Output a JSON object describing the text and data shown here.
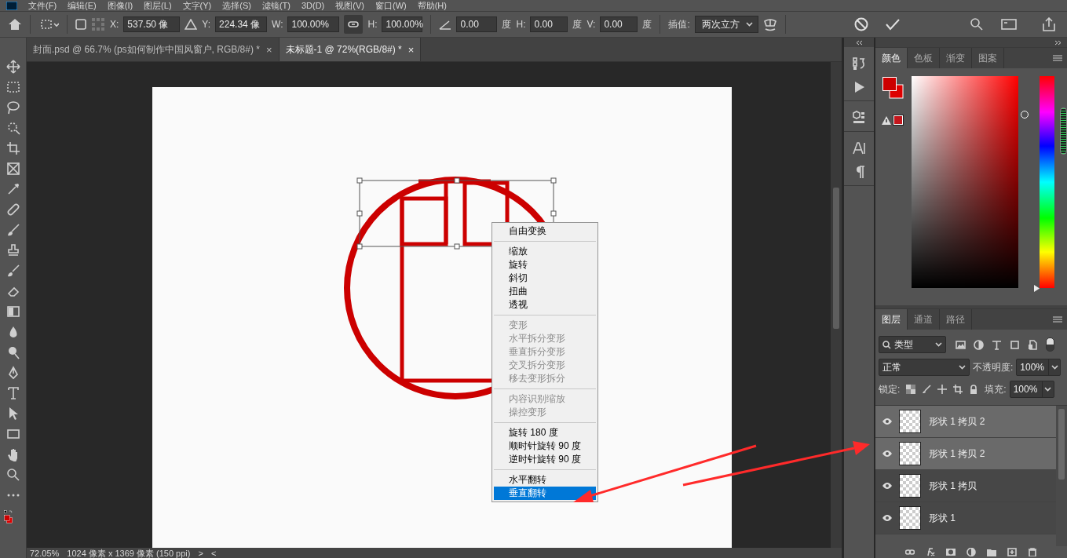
{
  "menu_bar": [
    "文件(F)",
    "编辑(E)",
    "图像(I)",
    "图层(L)",
    "文字(Y)",
    "选择(S)",
    "滤镜(T)",
    "3D(D)",
    "视图(V)",
    "窗口(W)",
    "帮助(H)"
  ],
  "options_bar": {
    "ref_point_checked": false,
    "x_label": "X:",
    "x_value": "537.50 像",
    "y_label": "Y:",
    "y_value": "224.34 像",
    "w_label": "W:",
    "w_value": "100.00%",
    "h_label": "H:",
    "h_value": "100.00%",
    "link_on": true,
    "angle_value": "0.00",
    "angle_unit": "度",
    "skew_h_label": "H:",
    "skew_h_value": "0.00",
    "skew_h_unit": "度",
    "skew_v_label": "V:",
    "skew_v_value": "0.00",
    "skew_v_unit": "度",
    "interp_label": "插值:",
    "interp_value": "两次立方"
  },
  "doc_tabs": [
    {
      "title": "封面.psd @ 66.7% (ps如何制作中国风窗户, RGB/8#) *",
      "close": "×",
      "selected": false
    },
    {
      "title": "未标题-1 @ 72%(RGB/8#) *",
      "close": "×",
      "selected": true
    }
  ],
  "context_menu": {
    "groups": [
      {
        "items": [
          {
            "label": "自由变换",
            "disabled": false,
            "selected": false
          }
        ]
      },
      {
        "items": [
          {
            "label": "缩放",
            "disabled": false,
            "selected": false
          },
          {
            "label": "旋转",
            "disabled": false,
            "selected": false
          },
          {
            "label": "斜切",
            "disabled": false,
            "selected": false
          },
          {
            "label": "扭曲",
            "disabled": false,
            "selected": false
          },
          {
            "label": "透视",
            "disabled": false,
            "selected": false
          }
        ]
      },
      {
        "items": [
          {
            "label": "变形",
            "disabled": true,
            "selected": false
          },
          {
            "label": "水平拆分变形",
            "disabled": true,
            "selected": false
          },
          {
            "label": "垂直拆分变形",
            "disabled": true,
            "selected": false
          },
          {
            "label": "交叉拆分变形",
            "disabled": true,
            "selected": false
          },
          {
            "label": "移去变形拆分",
            "disabled": true,
            "selected": false
          }
        ]
      },
      {
        "items": [
          {
            "label": "内容识别缩放",
            "disabled": true,
            "selected": false
          },
          {
            "label": "操控变形",
            "disabled": true,
            "selected": false
          }
        ]
      },
      {
        "items": [
          {
            "label": "旋转 180 度",
            "disabled": false,
            "selected": false
          },
          {
            "label": "顺时针旋转 90 度",
            "disabled": false,
            "selected": false
          },
          {
            "label": "逆时针旋转 90 度",
            "disabled": false,
            "selected": false
          }
        ]
      },
      {
        "items": [
          {
            "label": "水平翻转",
            "disabled": false,
            "selected": false
          },
          {
            "label": "垂直翻转",
            "disabled": false,
            "selected": true
          }
        ]
      }
    ]
  },
  "status_bar": {
    "zoom": "72.05%",
    "doc_info": "1024 像素 x 1369 像素 (150 ppi)",
    "next": ">",
    "prev": "<"
  },
  "color_panel": {
    "hue_slider": {
      "level": 0
    },
    "tabs": [
      {
        "label": "颜色",
        "selected": true
      },
      {
        "label": "色板",
        "selected": false
      },
      {
        "label": "渐变",
        "selected": false
      },
      {
        "label": "图案",
        "selected": false
      }
    ]
  },
  "layers_panel": {
    "tabs": [
      {
        "label": "图层",
        "selected": true
      },
      {
        "label": "通道",
        "selected": false
      },
      {
        "label": "路径",
        "selected": false
      }
    ],
    "filter": "类型",
    "blend_mode": "正常",
    "opacity_label": "不透明度:",
    "opacity": "100%",
    "lock_label": "锁定:",
    "fill_label": "填充:",
    "fill": "100%",
    "layers": [
      {
        "name": "形状 1 拷贝 2",
        "visible": true,
        "selected": true
      },
      {
        "name": "形状 1 拷贝 2",
        "visible": true,
        "selected": true
      },
      {
        "name": "形状 1 拷贝",
        "visible": true,
        "selected": false
      },
      {
        "name": "形状 1",
        "visible": true,
        "selected": false
      }
    ]
  }
}
